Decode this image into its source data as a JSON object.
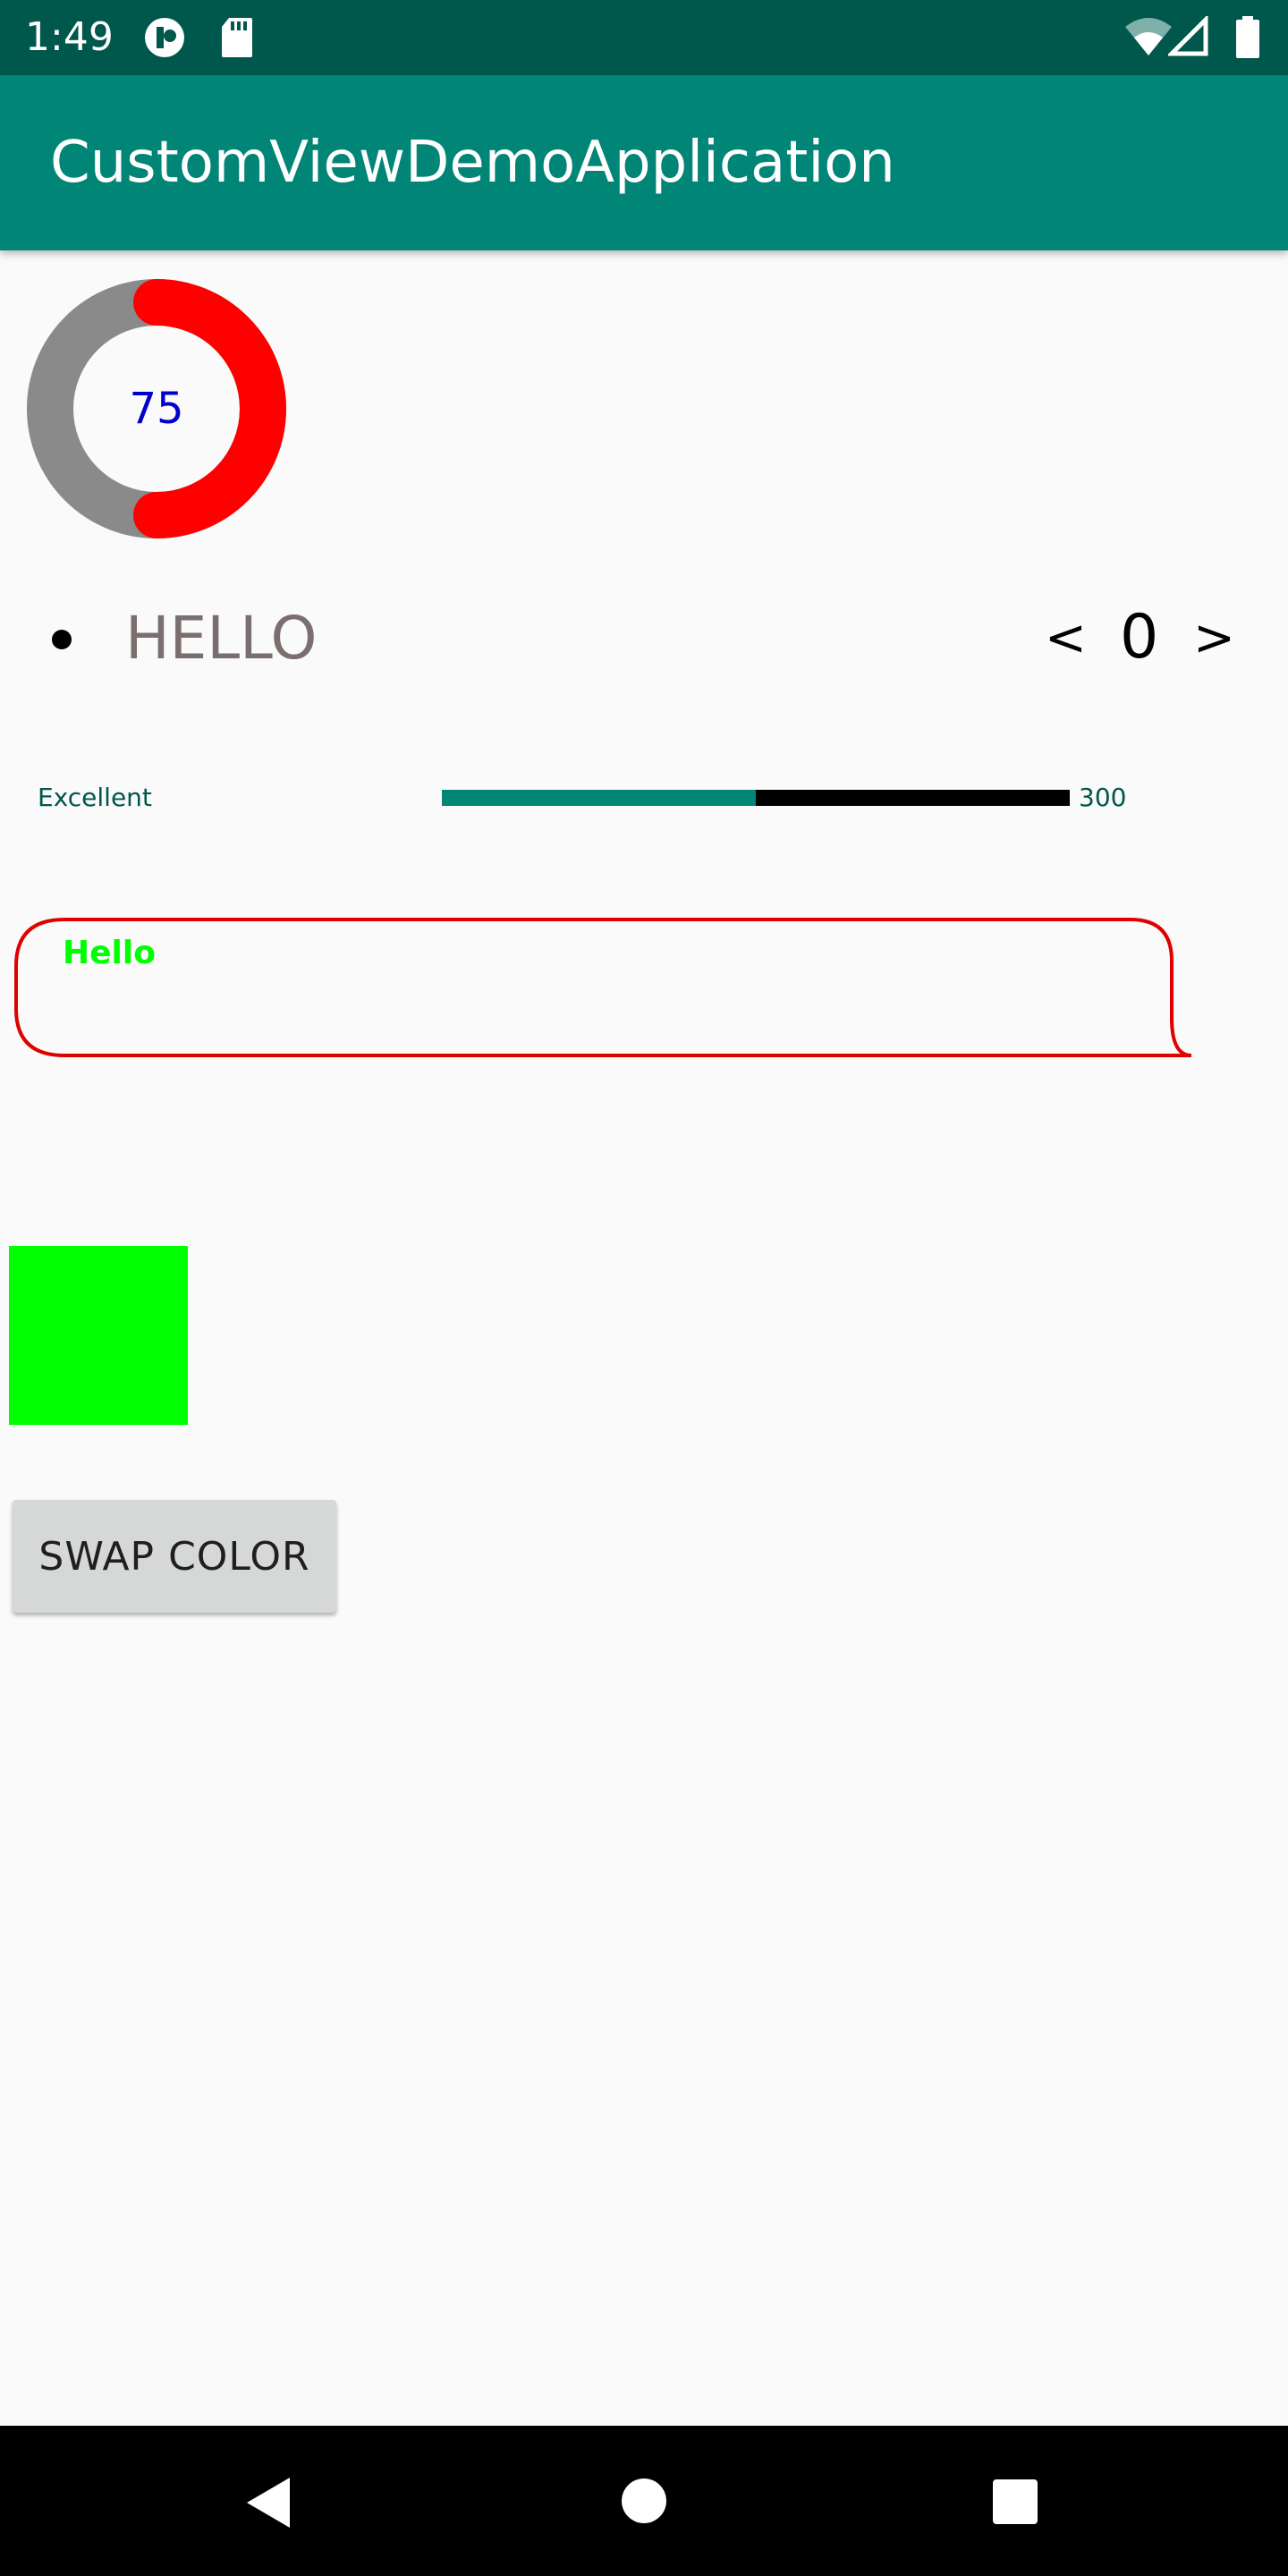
{
  "status_bar": {
    "time": "1:49",
    "left_icons": [
      "notification-app-icon",
      "sd-card-icon"
    ],
    "right_icons": [
      "wifi-icon",
      "cell-signal-icon",
      "battery-icon"
    ]
  },
  "app_bar": {
    "title": "CustomViewDemoApplication",
    "color": "#008577",
    "status_color": "#00574b"
  },
  "donut": {
    "value": "75",
    "progress_fraction": 0.5,
    "progress_color": "#ff0000",
    "track_color": "#8a8a8a",
    "value_color": "#0000cc"
  },
  "bullet_row": {
    "text": "HELLO",
    "prev_label": "<",
    "counter_value": "0",
    "next_label": ">"
  },
  "rating_bar": {
    "label": "Excellent",
    "max_label": "300",
    "fill_fraction": 0.5,
    "fill_color": "#008577",
    "track_color": "#000000"
  },
  "bubble": {
    "text": "Hello",
    "border_color": "#e00000",
    "text_color": "#00ff00"
  },
  "color_square": {
    "color": "#00ff00"
  },
  "swap_button": {
    "label": "SWAP COLOR"
  },
  "nav_bar": {
    "buttons": [
      "back-icon",
      "home-icon",
      "recents-icon"
    ]
  }
}
